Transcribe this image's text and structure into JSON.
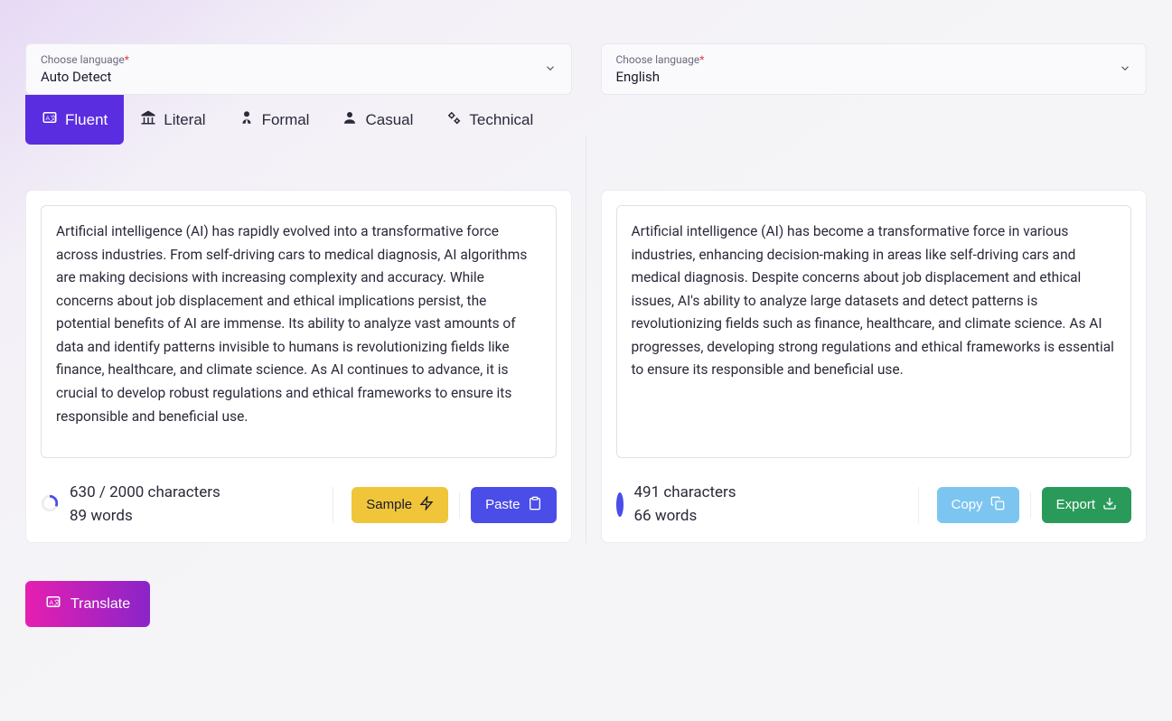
{
  "langSelect": {
    "label": "Choose language",
    "source": "Auto Detect",
    "target": "English"
  },
  "tabs": {
    "fluent": "Fluent",
    "literal": "Literal",
    "formal": "Formal",
    "casual": "Casual",
    "technical": "Technical"
  },
  "source": {
    "text": "Artificial intelligence (AI) has rapidly evolved into a transformative force across industries. From self-driving cars to medical diagnosis, AI algorithms are making decisions with increasing complexity and accuracy. While concerns about job displacement and ethical implications persist, the potential benefits of AI are immense. Its ability to analyze vast amounts of data and identify patterns invisible to humans is revolutionizing fields like finance, healthcare, and climate science. As AI continues to advance, it is crucial to develop robust regulations and ethical frameworks to ensure its responsible and beneficial use.",
    "chars": "630 / 2000 characters",
    "words": "89 words"
  },
  "target": {
    "text": "Artificial intelligence (AI) has become a transformative force in various industries, enhancing decision-making in areas like self-driving cars and medical diagnosis. Despite concerns about job displacement and ethical issues, AI's ability to analyze large datasets and detect patterns is revolutionizing fields such as finance, healthcare, and climate science. As AI progresses, developing strong regulations and ethical frameworks is essential to ensure its responsible and beneficial use.",
    "chars": "491 characters",
    "words": "66 words"
  },
  "buttons": {
    "sample": "Sample",
    "paste": "Paste",
    "copy": "Copy",
    "export": "Export",
    "translate": "Translate"
  }
}
